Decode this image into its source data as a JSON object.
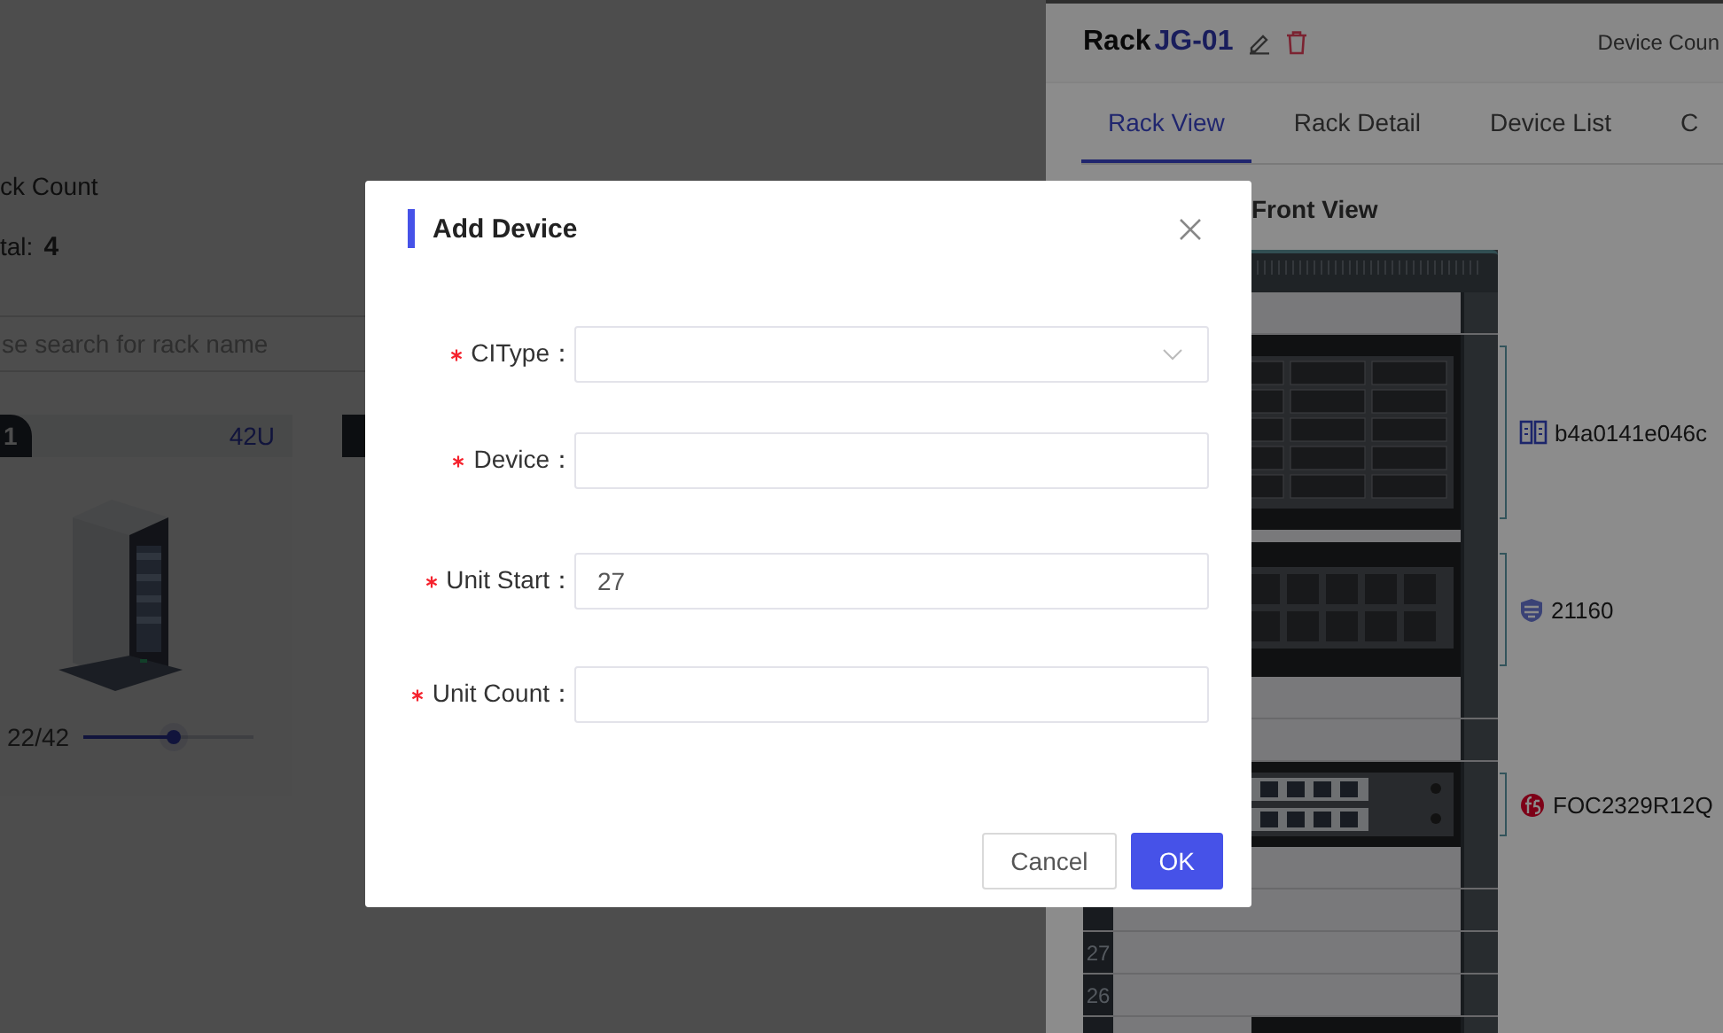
{
  "page": {
    "rack_count_title": "ck Count",
    "total_label": "tal:",
    "total_value": "4",
    "search": {
      "placeholder": "se search for rack name"
    },
    "rack_cards": [
      {
        "badge": "1",
        "size": "42U",
        "usage": "22/42",
        "level": 0.53
      },
      {
        "kind": "tab"
      }
    ]
  },
  "drawer": {
    "title": "Rack",
    "rack_name": "JG-01",
    "device_count_label": "Device Coun",
    "tabs": [
      {
        "label": "Rack View",
        "selected": true
      },
      {
        "label": "Rack Detail",
        "selected": false
      },
      {
        "label": "Device List",
        "selected": false
      },
      {
        "label": "C",
        "selected": false
      }
    ],
    "view_title": "Front View",
    "slots": [
      {
        "kind": "unit"
      },
      {
        "kind": "server",
        "label": "b4a0141e046c"
      },
      {
        "kind": "gap"
      },
      {
        "kind": "security",
        "label": "21160"
      },
      {
        "kind": "unit"
      },
      {
        "kind": "unit"
      },
      {
        "kind": "switch",
        "label": "FOC2329R12Q"
      },
      {
        "kind": "unit"
      },
      {
        "kind": "unit"
      },
      {
        "kind": "unit",
        "number": "27"
      },
      {
        "kind": "unit",
        "number": "26"
      },
      {
        "kind": "server"
      }
    ]
  },
  "dialog": {
    "title": "Add Device",
    "fields": [
      {
        "label": "CIType：",
        "required": true,
        "kind": "select"
      },
      {
        "label": "Device：",
        "required": true,
        "kind": "input"
      },
      {
        "label": "Unit Start：",
        "required": true,
        "kind": "input",
        "value": "27"
      },
      {
        "label": "Unit Count：",
        "required": true,
        "kind": "input"
      }
    ],
    "buttons": [
      {
        "label": "Cancel",
        "kind": "default"
      },
      {
        "label": "OK",
        "kind": "primary"
      }
    ]
  }
}
